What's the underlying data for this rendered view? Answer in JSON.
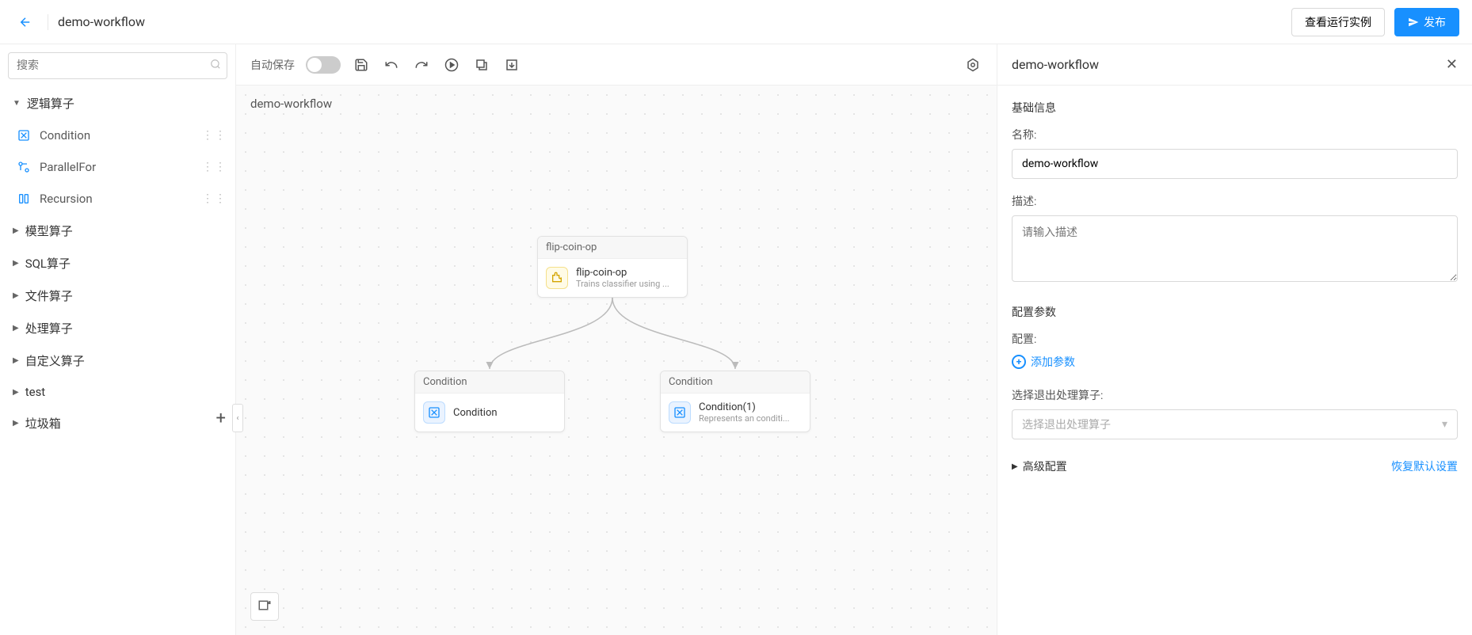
{
  "header": {
    "title": "demo-workflow",
    "view_instances_btn": "查看运行实例",
    "publish_btn": "发布"
  },
  "sidebar": {
    "search_placeholder": "搜索",
    "groups": [
      {
        "label": "逻辑算子",
        "expanded": true,
        "items": [
          {
            "label": "Condition",
            "icon": "condition-icon"
          },
          {
            "label": "ParallelFor",
            "icon": "parallel-icon"
          },
          {
            "label": "Recursion",
            "icon": "recursion-icon"
          }
        ]
      },
      {
        "label": "模型算子",
        "expanded": false
      },
      {
        "label": "SQL算子",
        "expanded": false
      },
      {
        "label": "文件算子",
        "expanded": false
      },
      {
        "label": "处理算子",
        "expanded": false
      },
      {
        "label": "自定义算子",
        "expanded": false
      },
      {
        "label": "test",
        "expanded": false
      },
      {
        "label": "垃圾箱",
        "expanded": false
      }
    ]
  },
  "toolbar": {
    "autosave_label": "自动保存"
  },
  "canvas": {
    "title": "demo-workflow",
    "nodes": {
      "n1": {
        "header": "flip-coin-op",
        "title": "flip-coin-op",
        "subtitle": "Trains classifier using ..."
      },
      "n2": {
        "header": "Condition",
        "title": "Condition",
        "subtitle": ""
      },
      "n3": {
        "header": "Condition",
        "title": "Condition(1)",
        "subtitle": "Represents an conditi..."
      }
    }
  },
  "panel": {
    "title": "demo-workflow",
    "sections": {
      "basic": "基础信息",
      "config": "配置参数"
    },
    "fields": {
      "name_label": "名称:",
      "name_value": "demo-workflow",
      "desc_label": "描述:",
      "desc_placeholder": "请输入描述",
      "config_label": "配置:",
      "add_param": "添加参数",
      "exit_label": "选择退出处理算子:",
      "exit_placeholder": "选择退出处理算子",
      "advanced": "高级配置",
      "restore": "恢复默认设置"
    }
  }
}
